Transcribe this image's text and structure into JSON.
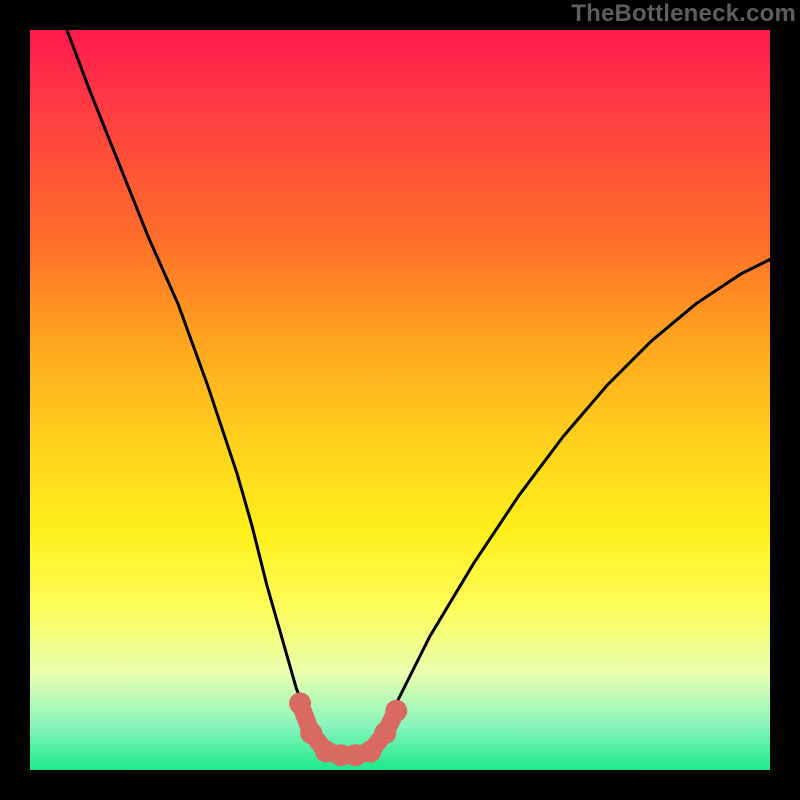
{
  "watermark": "TheBottleneck.com",
  "chart_data": {
    "type": "line",
    "title": "",
    "xlabel": "",
    "ylabel": "",
    "xlim": [
      0,
      100
    ],
    "ylim": [
      0,
      100
    ],
    "series": [
      {
        "name": "bottleneck-curve",
        "x": [
          5,
          8,
          12,
          16,
          20,
          24,
          28,
          30,
          32,
          34,
          36,
          38,
          40,
          42,
          44,
          46,
          48,
          50,
          54,
          60,
          66,
          72,
          78,
          84,
          90,
          96,
          100
        ],
        "y": [
          100,
          92,
          82,
          72,
          63,
          52,
          40,
          33,
          25,
          18,
          11,
          6,
          3,
          2,
          2,
          3,
          6,
          10,
          18,
          28,
          37,
          45,
          52,
          58,
          63,
          67,
          69
        ]
      }
    ],
    "points": [
      {
        "name": "marker-left-upper",
        "x": 36.5,
        "y": 9
      },
      {
        "name": "marker-left-mid",
        "x": 38,
        "y": 5
      },
      {
        "name": "marker-trough-1",
        "x": 40,
        "y": 2.5
      },
      {
        "name": "marker-trough-2",
        "x": 42,
        "y": 2
      },
      {
        "name": "marker-trough-3",
        "x": 44,
        "y": 2
      },
      {
        "name": "marker-trough-4",
        "x": 46,
        "y": 2.5
      },
      {
        "name": "marker-right-mid",
        "x": 48,
        "y": 5
      },
      {
        "name": "marker-right-upper",
        "x": 49.5,
        "y": 8
      }
    ],
    "colors": {
      "curve": "#000000",
      "markers": "#d96a62"
    }
  }
}
